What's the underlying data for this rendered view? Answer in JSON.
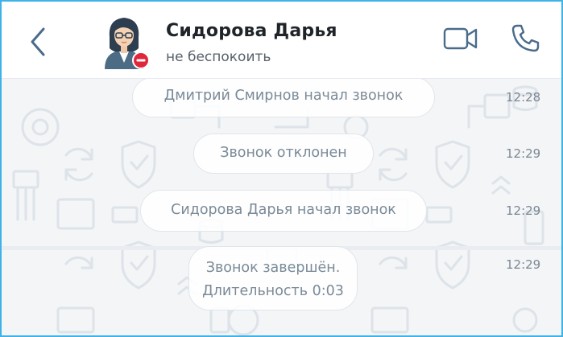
{
  "header": {
    "contact_name": "Сидорова Дарья",
    "status": "не беспокоить",
    "back_icon": "chevron-left-icon",
    "video_icon": "video-camera-icon",
    "phone_icon": "phone-icon",
    "status_icon": "do-not-disturb-icon",
    "accent_color": "#4a6b8a"
  },
  "messages": [
    {
      "text_lines": [
        "Дмитрий Смирнов начал звонок"
      ],
      "time": "12:28"
    },
    {
      "text_lines": [
        "Звонок отклонен"
      ],
      "time": "12:29"
    },
    {
      "text_lines": [
        "Сидорова Дарья начал звонок"
      ],
      "time": "12:29"
    },
    {
      "text_lines": [
        "Звонок завершён.",
        "Длительность 0:03"
      ],
      "time": "12:29"
    }
  ],
  "colors": {
    "frame_border": "#3fb2e8",
    "dnd_badge": "#e0263a",
    "system_text": "#7a8a98"
  }
}
